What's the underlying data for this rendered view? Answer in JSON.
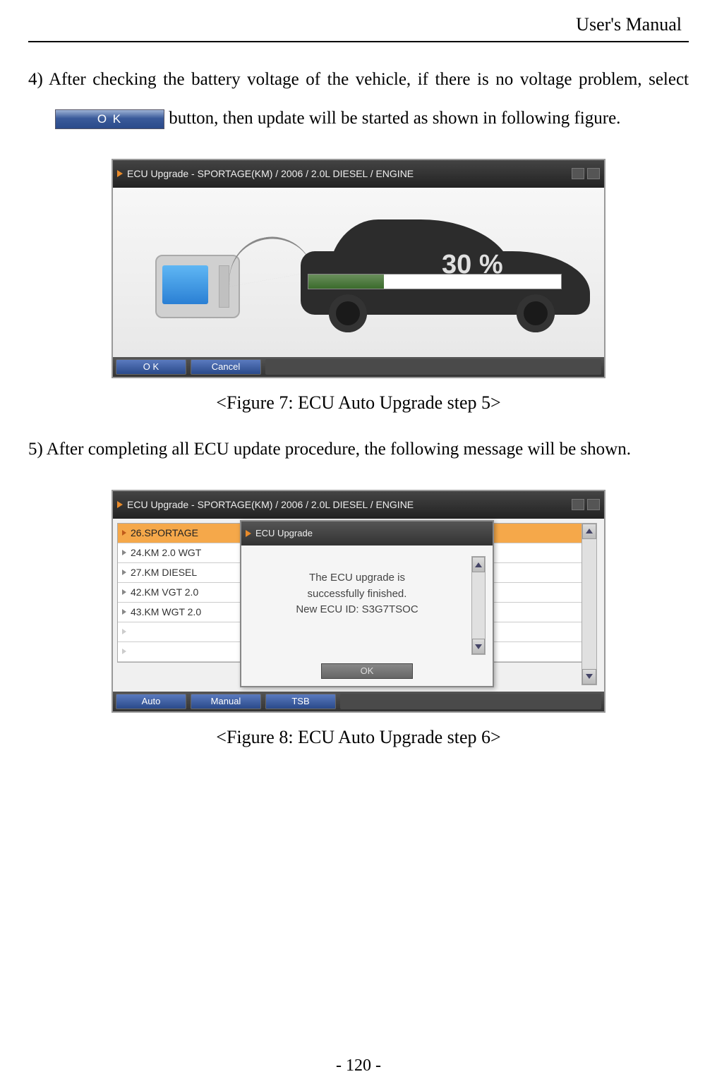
{
  "header": "User's Manual",
  "step4": {
    "label": "4) ",
    "text_before": "After checking the battery voltage of the vehicle, if there is no voltage problem, select ",
    "ok_button": "O K",
    "text_after": " button, then update will be started as shown in following figure."
  },
  "figure7": {
    "titlebar": "ECU Upgrade - SPORTAGE(KM) / 2006 / 2.0L DIESEL / ENGINE",
    "percent": "30 %",
    "buttons": {
      "ok": "O K",
      "cancel": "Cancel"
    },
    "caption": "<Figure 7: ECU Auto Upgrade step 5>"
  },
  "step5": {
    "label": "5) ",
    "text": "After completing all ECU update procedure, the following message will be shown."
  },
  "figure8": {
    "titlebar": "ECU Upgrade - SPORTAGE(KM) / 2006 / 2.0L DIESEL / ENGINE",
    "list": [
      "26.SPORTAGE ",
      "24.KM 2.0 WGT",
      "27.KM DIESEL ",
      "42.KM VGT 2.0",
      "43.KM WGT 2.0"
    ],
    "popup": {
      "title": "ECU Upgrade",
      "line1": "The ECU upgrade is",
      "line2": "successfully finished.",
      "line3": "New ECU ID: S3G7TSOC",
      "ok": "OK"
    },
    "buttons": {
      "auto": "Auto",
      "manual": "Manual",
      "tsb": "TSB"
    },
    "caption": "<Figure 8: ECU Auto Upgrade step 6>"
  },
  "page_number": "- 120 -"
}
